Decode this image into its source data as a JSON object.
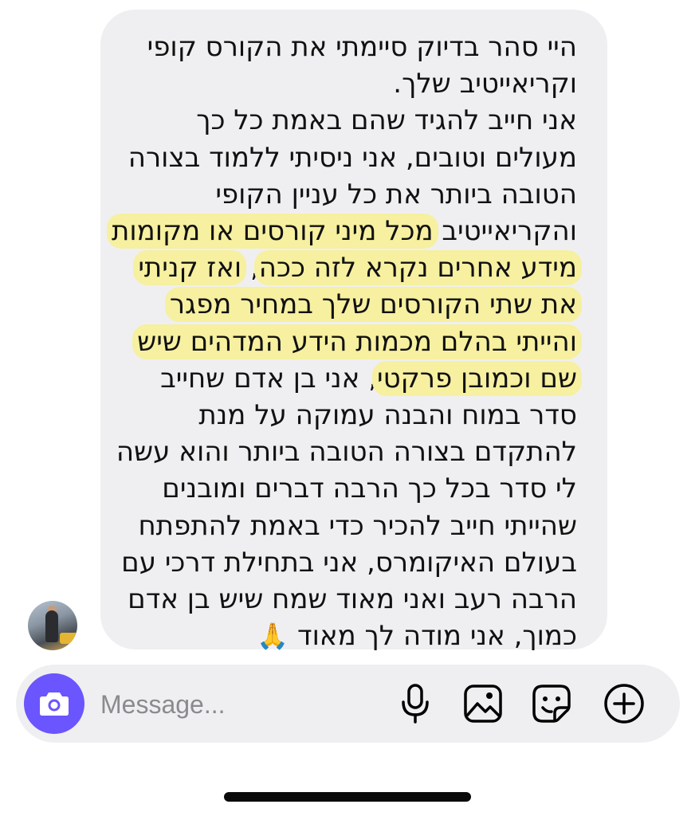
{
  "message": {
    "lines": [
      {
        "text": "היי סהר בדיוק סיימתי את הקורס קופי"
      },
      {
        "text": "וקריאייטיב שלך."
      },
      {
        "text": "אני חייב להגיד שהם באמת כל כך"
      },
      {
        "text": "מעולים וטובים, אני ניסיתי ללמוד בצורה"
      },
      {
        "text": "הטובה ביותר את כל עניין הקופי"
      },
      {
        "before": "והקריאייטיב ",
        "highlight": "מכל מיני קורסים או מקומות"
      },
      {
        "highlight_a": "מידע אחרים נקרא לזה ככה",
        "plain": ", ",
        "highlight_b": "ואז קניתי"
      },
      {
        "highlight": "את שתי הקורסים שלך במחיר מפגר"
      },
      {
        "highlight": "והייתי בהלם מכמות הידע המדהים שיש"
      },
      {
        "highlight": "שם וכמובן פרקטי",
        "after": ", אני בן אדם שחייב"
      },
      {
        "text": "סדר במוח והבנה עמוקה על מנת"
      },
      {
        "text": "להתקדם בצורה הטובה ביותר והוא עשה"
      },
      {
        "text": "לי סדר בכל כך הרבה דברים ומובנים"
      },
      {
        "text": "שהייתי חייב להכיר כדי באמת להתפתח"
      },
      {
        "text": "בעולם האיקומרס, אני בתחילת דרכי עם"
      },
      {
        "text": "הרבה רעב ואני מאוד שמח שיש בן אדם"
      },
      {
        "text": "כמוך, אני מודה לך מאוד",
        "emoji": "🙏"
      }
    ]
  },
  "composer": {
    "placeholder": "Message...",
    "value": ""
  },
  "icons": {
    "camera": "camera-icon",
    "mic": "microphone-icon",
    "gallery": "gallery-icon",
    "sticker": "sticker-icon",
    "add": "add-icon"
  },
  "colors": {
    "accent": "#6a55ff",
    "bubble": "#efeff1",
    "highlight": "#f6f0a0"
  }
}
